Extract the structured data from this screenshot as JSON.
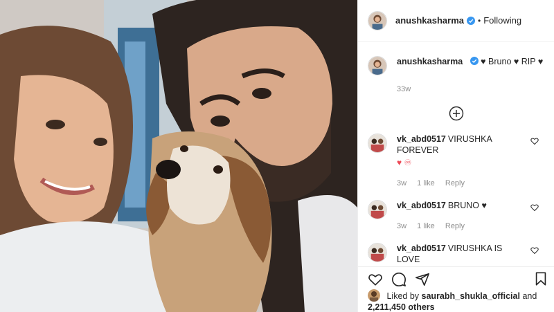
{
  "post": {
    "author": "anushkasharma",
    "follow_state": "Following",
    "dot": "•",
    "caption": "♥ Bruno ♥ RIP ♥",
    "time_ago": "33w"
  },
  "comments": [
    {
      "user": "vk_abd0517",
      "text": "VIRUSHKA FOREVER",
      "emoji": "♥ ♾",
      "time": "3w",
      "likes": "1 like",
      "reply": "Reply"
    },
    {
      "user": "vk_abd0517",
      "text": "BRUNO ♥",
      "emoji": "",
      "time": "3w",
      "likes": "1 like",
      "reply": "Reply"
    },
    {
      "user": "vk_abd0517",
      "text": "VIRUSHKA IS LOVE",
      "emoji": "❣😮😮",
      "time": "",
      "likes": "",
      "reply": ""
    }
  ],
  "likes": {
    "prefix": "Liked by",
    "user": "saurabh_shukla_official",
    "and": "and",
    "count": "2,211,450 others"
  },
  "colors": {
    "verified": "#3897f0",
    "heart": "#ed4956",
    "muted": "#8e8e8e",
    "text": "#262626"
  },
  "icons": [
    "verified-icon",
    "load-more-icon",
    "like-icon",
    "comment-icon",
    "share-icon",
    "save-icon"
  ]
}
